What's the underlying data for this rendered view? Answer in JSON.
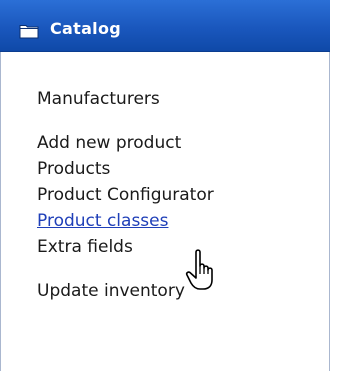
{
  "panel": {
    "title": "Catalog",
    "header_icon": "folder-icon"
  },
  "menu": {
    "items": [
      {
        "label": "Manufacturers"
      },
      {
        "label": "Add new product"
      },
      {
        "label": "Products"
      },
      {
        "label": "Product Configurator"
      },
      {
        "label": "Product classes",
        "state": "hovered"
      },
      {
        "label": "Extra fields"
      },
      {
        "label": "Update inventory"
      }
    ]
  },
  "cursor": {
    "icon": "hand-pointer-icon"
  },
  "colors": {
    "header_bg": "#1a57bd",
    "header_text": "#ffffff",
    "link_text": "#1a1a1a",
    "hover_link": "#1f3fb8",
    "panel_border": "#aab7cf"
  }
}
